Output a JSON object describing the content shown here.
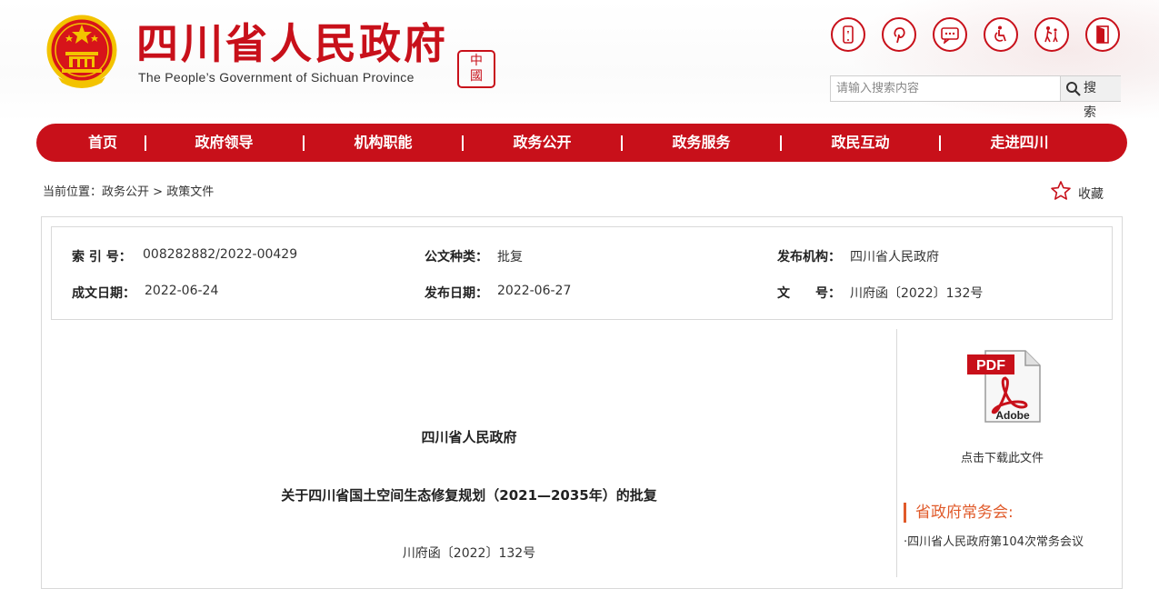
{
  "header": {
    "title": "四川省人民政府",
    "subtitle": "The People’s Government of Sichuan Province",
    "seal_text": "中國四川",
    "tool_icons": [
      "mobile-icon",
      "pinterest-icon",
      "message-icon",
      "accessibility-icon",
      "elderly-care-icon",
      "exit-door-icon"
    ],
    "search": {
      "placeholder": "请输入搜索内容",
      "button_label": "搜 索"
    }
  },
  "nav": {
    "items": [
      "首页",
      "政府领导",
      "机构职能",
      "政务公开",
      "政务服务",
      "政民互动",
      "走进四川"
    ]
  },
  "breadcrumb": {
    "prefix": "当前位置：",
    "items": [
      "政务公开",
      "政策文件"
    ],
    "separator": ">"
  },
  "favorite_label": "收藏",
  "meta": {
    "index_label": "索 引 号：",
    "index_value": "008282882/2022-00429",
    "type_label": "公文种类：",
    "type_value": "批复",
    "org_label": "发布机构：",
    "org_value": "四川省人民政府",
    "written_label": "成文日期：",
    "written_value": "2022-06-24",
    "publish_label": "发布日期：",
    "publish_value": "2022-06-27",
    "doc_label_1": "文",
    "doc_label_2": "号：",
    "doc_value": "川府函〔2022〕132号"
  },
  "document": {
    "org": "四川省人民政府",
    "title": "关于四川省国土空间生态修复规划（2021—2035年）的批复",
    "number": "川府函〔2022〕132号"
  },
  "sidebar": {
    "pdf_label": "PDF",
    "pdf_vendor": "Adobe",
    "download_label": "点击下载此文件",
    "meeting_heading": "省政府常务会:",
    "meeting_link": "·四川省人民政府第104次常务会议"
  },
  "colors": {
    "brand_red": "#c8101a",
    "accent_orange": "#e05a2a"
  }
}
